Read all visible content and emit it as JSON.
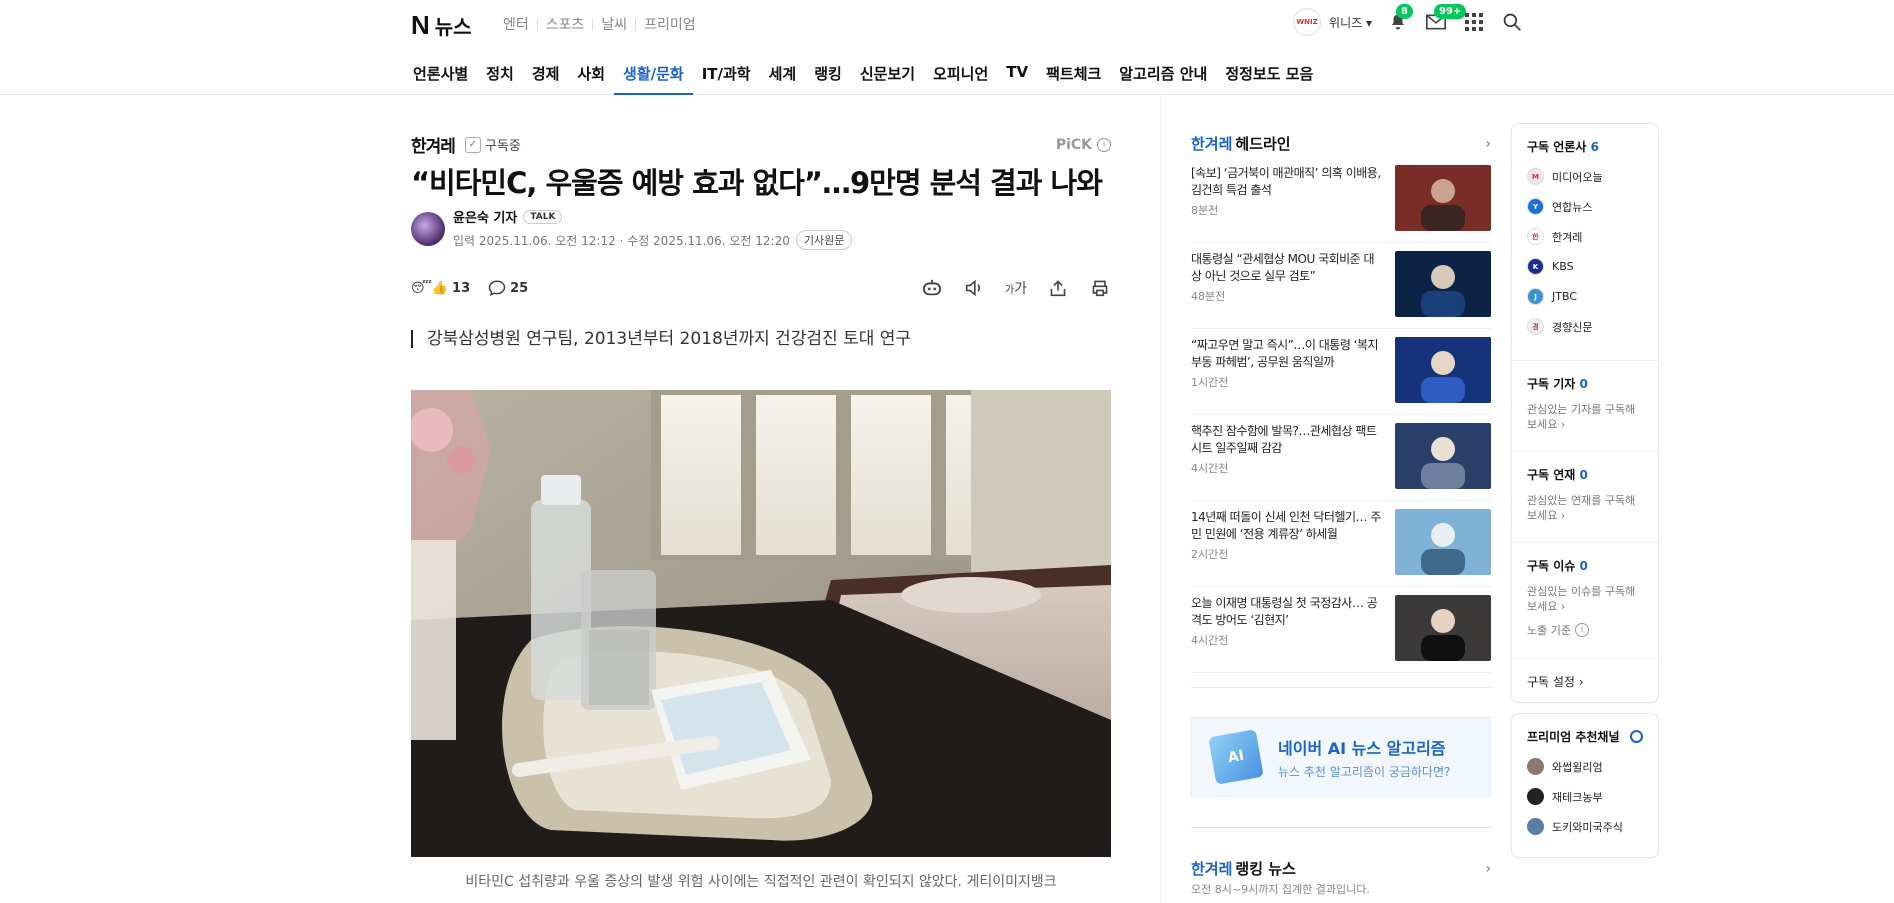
{
  "header": {
    "logo_text": "뉴스",
    "services": [
      "엔터",
      "스포츠",
      "날씨",
      "프리미엄"
    ],
    "user_badge": "WNIZ",
    "user_name": "위니즈",
    "alarm_count": "8",
    "mail_count": "99+"
  },
  "nav": {
    "tabs": [
      {
        "label": "언론사별"
      },
      {
        "label": "정치"
      },
      {
        "label": "경제"
      },
      {
        "label": "사회"
      },
      {
        "label": "생활/문화"
      },
      {
        "label": "IT/과학"
      },
      {
        "label": "세계"
      },
      {
        "label": "랭킹"
      },
      {
        "label": "신문보기"
      },
      {
        "label": "오피니언"
      },
      {
        "label": "TV"
      },
      {
        "label": "팩트체크"
      },
      {
        "label": "알고리즘 안내"
      },
      {
        "label": "정정보도 모음"
      }
    ],
    "active_index": 4
  },
  "article": {
    "press": "한겨레",
    "subscribe_label": "구독중",
    "pick_label": "PiCK",
    "title": "“비타민C, 우울증 예방 효과 없다”…9만명 분석 결과 나와",
    "reporter": "윤은숙 기자",
    "talk_label": "TALK",
    "dates": "입력 2025.11.06. 오전 12:12 · 수정 2025.11.06. 오전 12:20",
    "origin_label": "기사원문",
    "reaction_count": "13",
    "comment_count": "25",
    "font_label": "가",
    "subheading": "강북삼성병원 연구팀, 2013년부터 2018년까지 건강검진 토대 연구",
    "caption": "비타민C 섭취량과 우울 증상의 발생 위험 사이에는 직접적인 관련이 확인되지 않았다. 게티이미지뱅크"
  },
  "headline_section": {
    "brand": "한겨레",
    "title": "헤드라인",
    "items": [
      {
        "title": "[속보] ‘금거북이 매관매직’ 의혹 이배용, 김건희 특검 출석",
        "time": "8분전"
      },
      {
        "title": "대통령실 “관세협상 MOU 국회비준 대상 아닌 것으로 실무 검토”",
        "time": "48분전"
      },
      {
        "title": "“짜고우면 말고 즉시”…이 대통령 ‘복지부동 파헤범’, 공무원 움직일까",
        "time": "1시간전"
      },
      {
        "title": "핵추진 잠수함에 발목?…관세협상 팩트시트 일주일째 감감",
        "time": "4시간전"
      },
      {
        "title": "14년째 떠돌이 신세 인천 닥터헬기… 주민 민원에 ‘전용 계류장’ 하세월",
        "time": "2시간전"
      },
      {
        "title": "오늘 이재명 대통령실 첫 국정감사… 공격도 방어도 ‘김현지’",
        "time": "4시간전"
      }
    ]
  },
  "ai_banner": {
    "icon_label": "AI",
    "title": "네이버 AI 뉴스 알고리즘",
    "subtitle": "뉴스 추천 알고리즘이 궁금하다면?"
  },
  "ranking_section": {
    "brand": "한겨레",
    "title": "랭킹 뉴스",
    "subtitle": "오전 8시~9시까지 집계한 결과입니다."
  },
  "subscriptions": {
    "press_title": "구독 언론사",
    "press_count": "6",
    "press_list": [
      {
        "name": "미디어오늘",
        "color": "#e8e8e8",
        "mark": "M"
      },
      {
        "name": "연합뉴스",
        "color": "#1e6fd6",
        "mark": "Y"
      },
      {
        "name": "한겨레",
        "color": "#ffffff",
        "mark": "한"
      },
      {
        "name": "KBS",
        "color": "#1a2f8f",
        "mark": "K"
      },
      {
        "name": "JTBC",
        "color": "#3d8fd6",
        "mark": "J"
      },
      {
        "name": "경향신문",
        "color": "#eeeeee",
        "mark": "경"
      }
    ],
    "reporter_title": "구독 기자",
    "reporter_count": "0",
    "reporter_desc": "관심있는 기자를 구독해 보세요",
    "series_title": "구독 연재",
    "series_count": "0",
    "series_desc": "관심있는 연재를 구독해 보세요",
    "issue_title": "구독 이슈",
    "issue_count": "0",
    "issue_desc": "관심있는 이슈를 구독해 보세요",
    "criteria_label": "노출 기준",
    "settings_label": "구독 설정"
  },
  "premium": {
    "title": "프리미엄 추천채널",
    "channels": [
      {
        "name": "와썹윌리엄",
        "color": "#8a7a6a"
      },
      {
        "name": "재테크농부",
        "color": "#222222"
      },
      {
        "name": "도키와미국주식",
        "color": "#5a7ea8"
      }
    ]
  }
}
